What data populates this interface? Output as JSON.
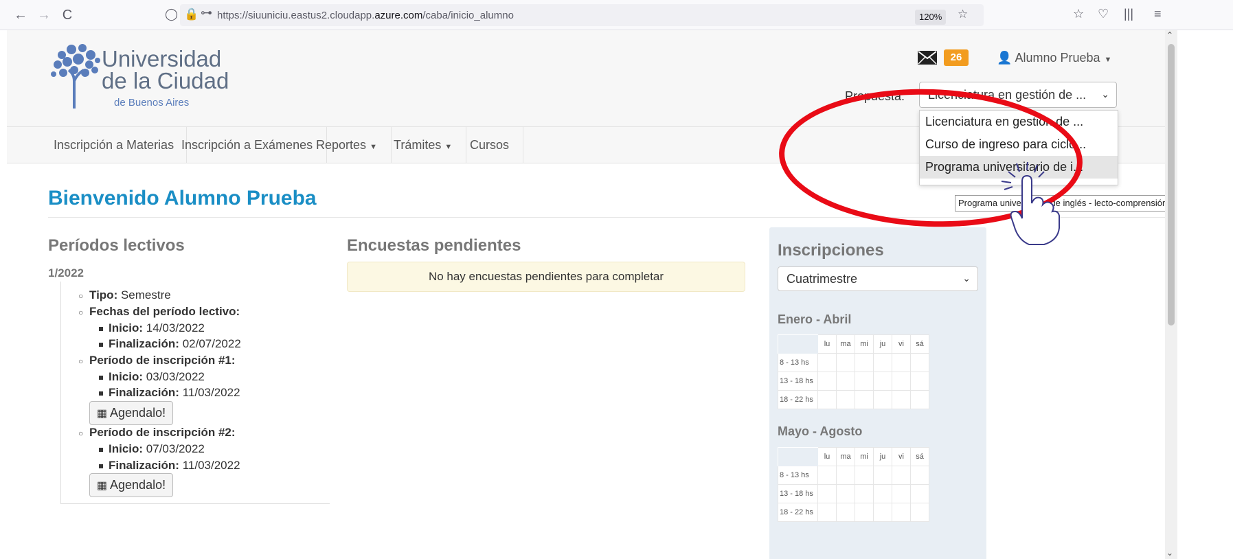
{
  "browser": {
    "back": "←",
    "forward": "→",
    "reload": "C",
    "url_prefix": "https://siuuniciu.eastus2.cloudapp.",
    "url_domain": "azure.com",
    "url_path": "/caba/inicio_alumno",
    "zoom": "120%"
  },
  "header": {
    "logo_line1": "Universidad",
    "logo_line2": "de la Ciudad",
    "logo_sub": "de Buenos Aires",
    "message_count": "26",
    "user_name": "Alumno Prueba",
    "propuesta_label": "Propuesta:",
    "propuesta_selected": "Licenciatura en gestión de ..."
  },
  "dropdown": {
    "options": [
      "Licenciatura en gestión de ...",
      "Curso de ingreso para ciclo...",
      "Programa universitario de i..."
    ],
    "tooltip": "Programa universitario de inglés - lecto-comprensión"
  },
  "nav": [
    "Inscripción a Materias",
    "Inscripción a Exámenes",
    "Reportes",
    "Trámites",
    "Cursos"
  ],
  "main": {
    "welcome": "Bienvenido Alumno Prueba",
    "periodos_title": "Períodos lectivos",
    "periodo": {
      "name": "1/2022",
      "tipo_label": "Tipo:",
      "tipo_value": "Semestre",
      "fechas_label": "Fechas del período lectivo:",
      "inicio_label": "Inicio:",
      "inicio_value": "14/03/2022",
      "fin_label": "Finalización:",
      "fin_value": "02/07/2022",
      "insc1_label": "Período de inscripción #1:",
      "insc1_inicio": "03/03/2022",
      "insc1_fin": "11/03/2022",
      "insc2_label": "Período de inscripción #2:",
      "insc2_inicio": "07/03/2022",
      "insc2_fin": "11/03/2022",
      "agenda_label": "Agendalo!"
    },
    "encuestas_title": "Encuestas pendientes",
    "encuestas_empty": "No hay encuestas pendientes para completar"
  },
  "inscripciones": {
    "title": "Inscripciones",
    "selected": "Cuatrimestre",
    "days": [
      "lu",
      "ma",
      "mi",
      "ju",
      "vi",
      "sá"
    ],
    "slots": [
      "8 - 13 hs",
      "13 - 18 hs",
      "18 - 22 hs"
    ],
    "period1": "Enero - Abril",
    "period2": "Mayo - Agosto"
  },
  "colors": {
    "accent": "#1a8ec5",
    "badge": "#f29c1f",
    "annotation": "#e90b16"
  }
}
